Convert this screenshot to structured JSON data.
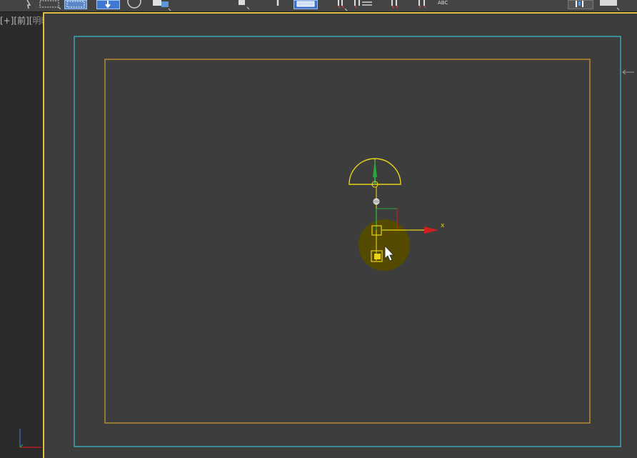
{
  "viewport": {
    "label_plus": "[+]",
    "label_view": "[前]",
    "label_shading_open": "[",
    "label_shading": "明暗处理",
    "label_shading_close": "]"
  },
  "gizmo": {
    "x_axis_label": "x"
  },
  "toolbar": {
    "abc_label": "ABC",
    "icons": [
      "select-arrow-icon",
      "region-select-icon",
      "window-crossing-icon",
      "move-icon",
      "rotate-icon",
      "scale-icon",
      "pivot-icon",
      "manipulate-icon",
      "snap-toggle-icon",
      "mirror-icon",
      "align-icon",
      "layer-icon",
      "curve-editor-icon",
      "abc-text-icon",
      "render-setup-icon",
      "render-frame-icon"
    ]
  },
  "colors": {
    "viewport_bg": "#3d3d3d",
    "safe_frame_outer": "#39b9c9",
    "safe_frame_inner": "#c8962a",
    "gizmo_yellow": "#e8d21a",
    "gizmo_green": "#27a83a",
    "gizmo_red": "#d01d1d",
    "cursor_highlight": "#5a5000"
  }
}
